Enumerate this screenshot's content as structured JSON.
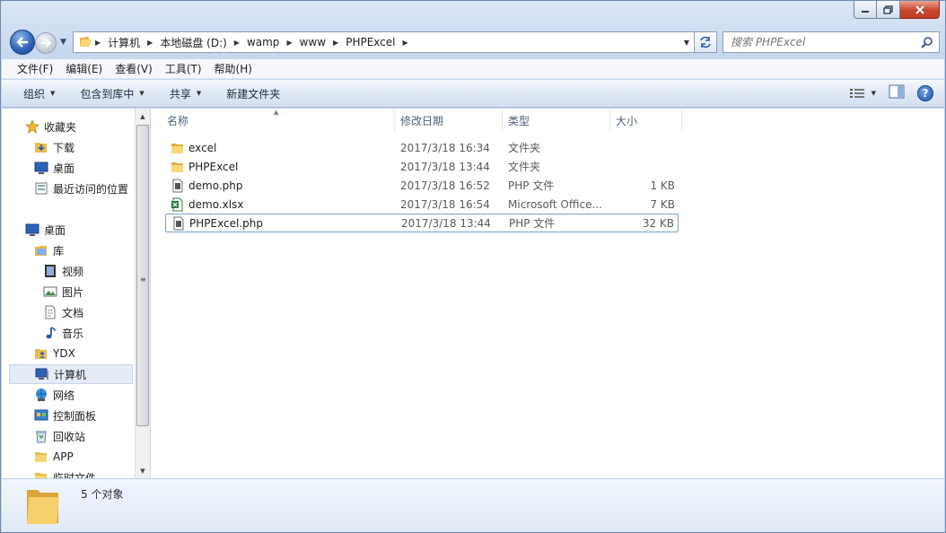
{
  "window": {
    "caption_buttons": [
      "minimize",
      "maximize",
      "close"
    ]
  },
  "address_bar": {
    "crumbs": [
      "计算机",
      "本地磁盘 (D:)",
      "wamp",
      "www",
      "PHPExcel"
    ]
  },
  "search": {
    "placeholder": "搜索 PHPExcel"
  },
  "menu": [
    "文件(F)",
    "编辑(E)",
    "查看(V)",
    "工具(T)",
    "帮助(H)"
  ],
  "commands": {
    "organize": "组织",
    "include_in_library": "包含到库中",
    "share": "共享",
    "new_folder": "新建文件夹"
  },
  "nav": {
    "favorites": {
      "label": "收藏夹",
      "items": [
        "下载",
        "桌面",
        "最近访问的位置"
      ]
    },
    "desktop": "桌面",
    "library": {
      "label": "库",
      "items": [
        "视频",
        "图片",
        "文档",
        "音乐"
      ]
    },
    "other": [
      "YDX",
      "计算机",
      "网络",
      "控制面板",
      "回收站",
      "APP",
      "临时文件"
    ]
  },
  "columns": {
    "name": "名称",
    "date": "修改日期",
    "type": "类型",
    "size": "大小"
  },
  "files": [
    {
      "name": "excel",
      "date": "2017/3/18 16:34",
      "type": "文件夹",
      "size": "",
      "icon": "folder-icon"
    },
    {
      "name": "PHPExcel",
      "date": "2017/3/18 13:44",
      "type": "文件夹",
      "size": "",
      "icon": "folder-icon"
    },
    {
      "name": "demo.php",
      "date": "2017/3/18 16:52",
      "type": "PHP 文件",
      "size": "1 KB",
      "icon": "php-file-icon"
    },
    {
      "name": "demo.xlsx",
      "date": "2017/3/18 16:54",
      "type": "Microsoft Office...",
      "size": "7 KB",
      "icon": "excel-file-icon"
    },
    {
      "name": "PHPExcel.php",
      "date": "2017/3/18 13:44",
      "type": "PHP 文件",
      "size": "32 KB",
      "icon": "php-file-icon"
    }
  ],
  "status": {
    "count": "5 个对象"
  },
  "colors": {
    "accent": "#2b5fb8",
    "selection": "#e3ecf7",
    "focus_border": "#7da2ce"
  }
}
